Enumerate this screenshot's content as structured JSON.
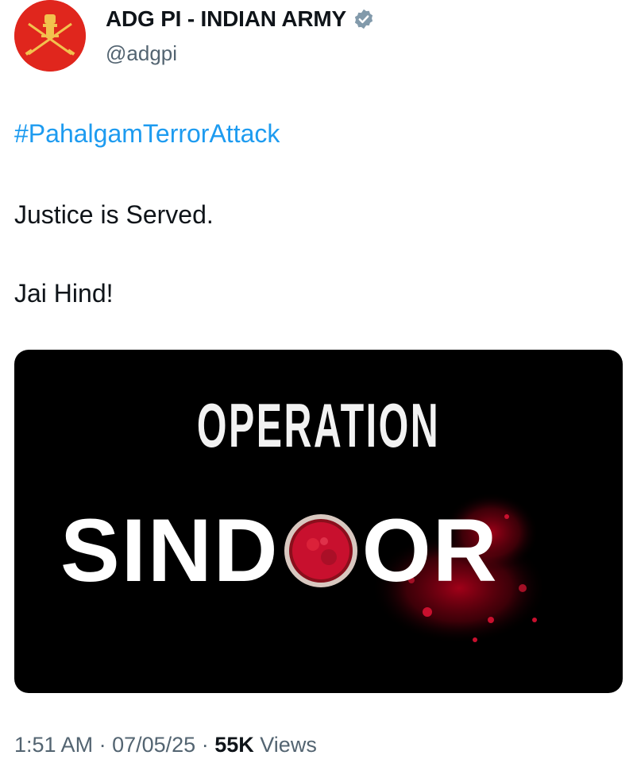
{
  "author": {
    "display_name": "ADG PI - INDIAN ARMY",
    "handle": "@adgpi",
    "avatar_icon": "indian-army-emblem-icon",
    "verified_icon": "verified-badge-icon",
    "avatar_color": "#e0261d"
  },
  "tweet": {
    "hashtag": "#PahalgamTerrorAttack",
    "lines": [
      "Justice is Served.",
      "Jai Hind!"
    ]
  },
  "media": {
    "title_top": "OPERATION",
    "title_bottom_left": "SIND",
    "title_bottom_right": "OR"
  },
  "meta": {
    "time": "1:51 AM",
    "separator": "·",
    "date": "07/05/25",
    "views_count": "55K",
    "views_label": "Views"
  },
  "colors": {
    "link": "#1d9bf0",
    "muted": "#536471",
    "text": "#0f1419",
    "sindoor_red": "#c8102e"
  }
}
